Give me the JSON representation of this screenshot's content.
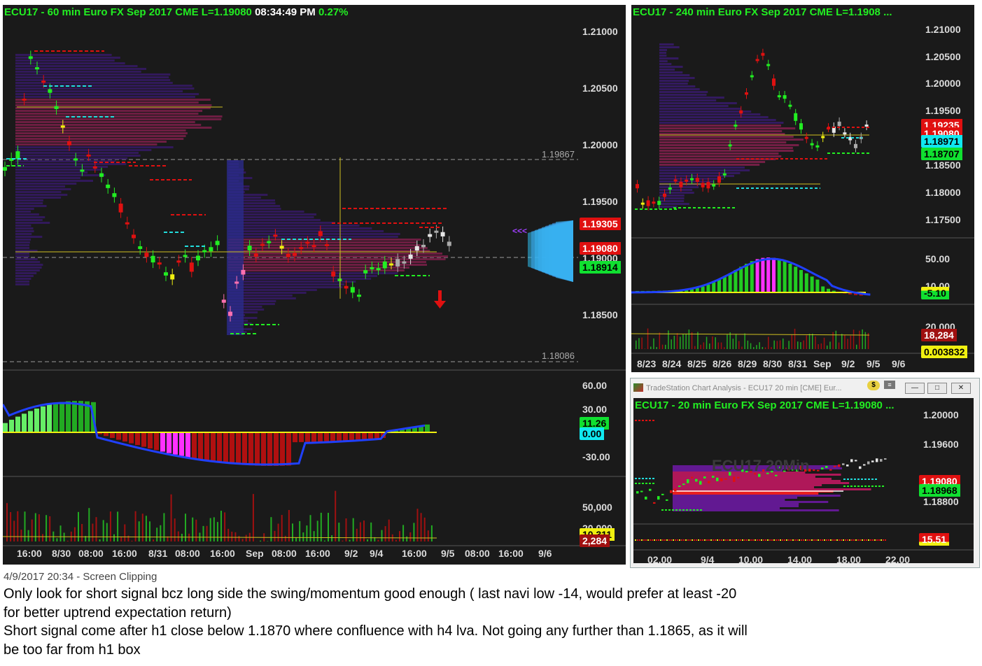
{
  "main_chart": {
    "title_prefix": "ECU17 - 60 min  Euro FX Sep 2017  CME  L=1.19080",
    "title_time": "08:34:49 PM",
    "title_change": "0.27%",
    "price_ticks": [
      "1.21000",
      "1.20500",
      "1.20000",
      "1.19500",
      "1.19000",
      "1.18500"
    ],
    "ref_lines": [
      "1.19867",
      "1.18086"
    ],
    "tags": {
      "upper": "1.19305",
      "last": "1.19080",
      "lower": "1.18914"
    },
    "osc_ticks": [
      "60.00",
      "30.00",
      "-30.00"
    ],
    "osc_tags": {
      "a": "11.26",
      "b": "0.00"
    },
    "vol_ticks": [
      "50,000",
      "20,000"
    ],
    "vol_tags": {
      "a": "10,311",
      "b": "2,284"
    },
    "x_labels": [
      "16:00",
      "8/30",
      "08:00",
      "16:00",
      "8/31",
      "08:00",
      "16:00",
      "Sep",
      "08:00",
      "16:00",
      "9/2",
      "9/4",
      "16:00",
      "9/5",
      "08:00",
      "16:00",
      "9/6"
    ],
    "arrow_marker": "<<<"
  },
  "h4_chart": {
    "title": "ECU17 - 240 min  Euro FX Sep 2017  CME  L=1.1908 ...",
    "price_ticks": [
      "1.21000",
      "1.20500",
      "1.20000",
      "1.19500",
      "1.18500",
      "1.18000",
      "1.17500"
    ],
    "tags": {
      "a": "1.19235",
      "b": "1.19080",
      "c": "1.18971",
      "d": "1.18707"
    },
    "osc_ticks": [
      "50.00",
      "10.00"
    ],
    "osc_tag": "-5.10",
    "vol_ticks": [
      "20,000"
    ],
    "vol_tags": {
      "a": "18,284",
      "b": "0.003832"
    },
    "x_labels": [
      "8/23",
      "8/24",
      "8/25",
      "8/26",
      "8/29",
      "8/30",
      "8/31",
      "Sep",
      "9/2",
      "9/5",
      "9/6"
    ]
  },
  "m20_window": {
    "window_title": "TradeStation Chart Analysis - ECU17 20 min [CME] Eur...",
    "title": "ECU17 - 20 min  Euro FX Sep 2017  CME  L=1.19080 ...",
    "watermark": "ECU17 20Min",
    "price_ticks": [
      "1.20000",
      "1.19600",
      "1.18800"
    ],
    "tags": {
      "a": "1.19080",
      "b": "1.18968"
    },
    "osc_tag": "15.51",
    "x_labels": [
      "02.00",
      "9/4",
      "10.00",
      "14.00",
      "18.00",
      "22.00"
    ],
    "buttons": {
      "minimize": "—",
      "restore": "□",
      "close": "✕"
    }
  },
  "notes": {
    "caption": "4/9/2017 20:34 - Screen Clipping",
    "line1": "Only look for short signal bcz long side the swing/momentum good enough ( last navi low -14, would prefer at least -20",
    "line2": "for better uptrend expectation return)",
    "line3": "Short signal come after h1 close below 1.1870 where confluence with h4 lva. Not going any further than 1.1865, as it will",
    "line4": "be too far from h1 box"
  },
  "colors": {
    "bg": "#1a1a1a",
    "up": "#22ee22",
    "down": "#e01010",
    "title": "#22ee22"
  }
}
